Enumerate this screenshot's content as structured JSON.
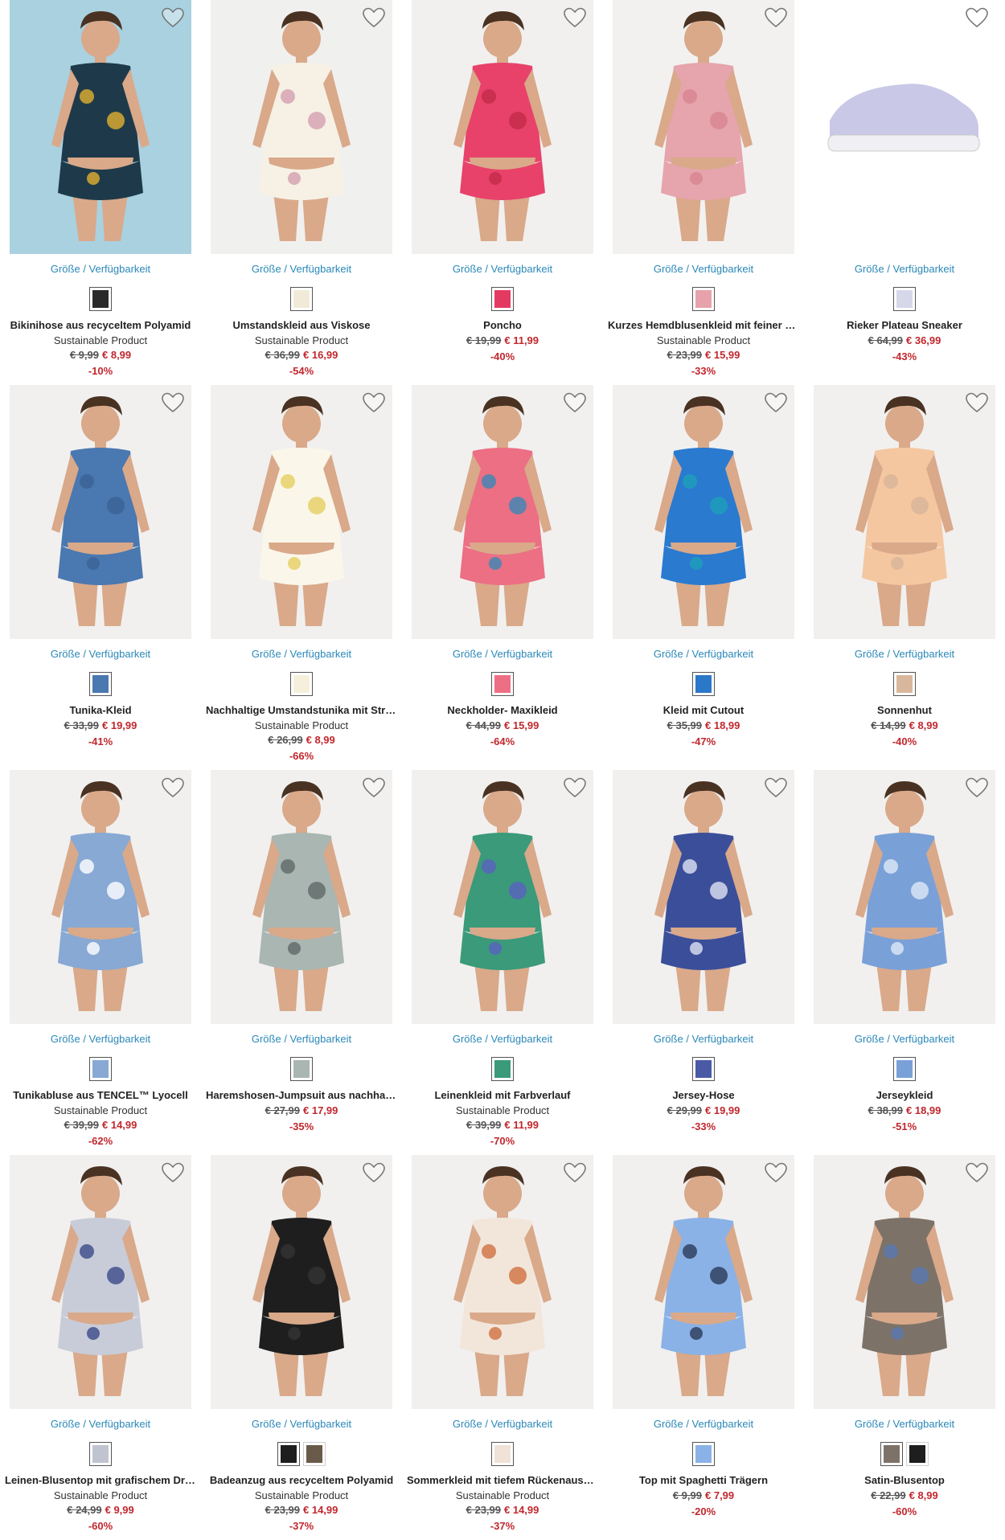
{
  "labels": {
    "availability": "Größe / Verfügbarkeit"
  },
  "products": [
    {
      "name": "Bikinihose aus recyceltem Polyamid",
      "sustainable": "Sustainable Product",
      "old_price": "€ 9,99",
      "new_price": "€ 8,99",
      "discount": "-10%",
      "bg": "#a9d1e0",
      "garment": "#1e3a4a",
      "accent": "#e0b030",
      "swatches": [
        "#2a2a2a"
      ]
    },
    {
      "name": "Umstandskleid aus Viskose",
      "sustainable": "Sustainable Product",
      "old_price": "€ 36,99",
      "new_price": "€ 16,99",
      "discount": "-54%",
      "bg": "#f0f0ee",
      "garment": "#f6f1e4",
      "accent": "#d4a0b0",
      "swatches": [
        "#f1ead8"
      ]
    },
    {
      "name": "Poncho",
      "sustainable": "",
      "old_price": "€ 19,99",
      "new_price": "€ 11,99",
      "discount": "-40%",
      "bg": "#f1f0ef",
      "garment": "#e8426a",
      "accent": "#c22a4a",
      "swatches": [
        "#e43a62"
      ]
    },
    {
      "name": "Kurzes Hemdblusenkleid mit feiner Struktur",
      "sustainable": "Sustainable Product",
      "old_price": "€ 23,99",
      "new_price": "€ 15,99",
      "discount": "-33%",
      "bg": "#f2f1f0",
      "garment": "#e6a4ad",
      "accent": "#d7848f",
      "swatches": [
        "#e7a2ab"
      ]
    },
    {
      "name": "Rieker Plateau Sneaker",
      "sustainable": "",
      "old_price": "€ 64,99",
      "new_price": "€ 36,99",
      "discount": "-43%",
      "bg": "#ffffff",
      "garment": "#c9c8e6",
      "accent": "#efeff4",
      "swatches": [
        "#d7d7ea"
      ]
    },
    {
      "name": "Tunika-Kleid",
      "sustainable": "",
      "old_price": "€ 33,99",
      "new_price": "€ 19,99",
      "discount": "-41%",
      "bg": "#f1f0ef",
      "garment": "#4a78b0",
      "accent": "#3a6196",
      "swatches": [
        "#4a78b0"
      ]
    },
    {
      "name": "Nachhaltige Umstandstunika mit Stretch",
      "sustainable": "Sustainable Product",
      "old_price": "€ 26,99",
      "new_price": "€ 8,99",
      "discount": "-66%",
      "bg": "#f1f0ef",
      "garment": "#faf7ea",
      "accent": "#e6cd60",
      "swatches": [
        "#f5f0dc"
      ]
    },
    {
      "name": "Neckholder- Maxikleid",
      "sustainable": "",
      "old_price": "€ 44,99",
      "new_price": "€ 15,99",
      "discount": "-64%",
      "bg": "#f1f0ef",
      "garment": "#ec6f84",
      "accent": "#3a88b8",
      "swatches": [
        "#ec6f84"
      ]
    },
    {
      "name": "Kleid mit Cutout",
      "sustainable": "",
      "old_price": "€ 35,99",
      "new_price": "€ 18,99",
      "discount": "-47%",
      "bg": "#f1f0ef",
      "garment": "#2a7ad0",
      "accent": "#1ea0b8",
      "swatches": [
        "#2a78c8"
      ]
    },
    {
      "name": "Sonnenhut",
      "sustainable": "",
      "old_price": "€ 14,99",
      "new_price": "€ 8,99",
      "discount": "-40%",
      "bg": "#f1f0ef",
      "garment": "#f5c7a0",
      "accent": "#d8b49a",
      "swatches": [
        "#d9b79c"
      ]
    },
    {
      "name": "Tunikabluse aus TENCEL™ Lyocell",
      "sustainable": "Sustainable Product",
      "old_price": "€ 39,99",
      "new_price": "€ 14,99",
      "discount": "-62%",
      "bg": "#f1f0ef",
      "garment": "#87a9d4",
      "accent": "#ffffff",
      "swatches": [
        "#87a9d4"
      ]
    },
    {
      "name": "Haremshosen-Jumpsuit aus nachhaltiger Viskose",
      "sustainable": "",
      "old_price": "€ 27,99",
      "new_price": "€ 17,99",
      "discount": "-35%",
      "bg": "#f1f0ef",
      "garment": "#a9b6b2",
      "accent": "#5f6a68",
      "swatches": [
        "#a9b6b2"
      ]
    },
    {
      "name": "Leinenkleid mit Farbverlauf",
      "sustainable": "Sustainable Product",
      "old_price": "€ 39,99",
      "new_price": "€ 11,99",
      "discount": "-70%",
      "bg": "#f1f0ef",
      "garment": "#3a9a7a",
      "accent": "#5a60c0",
      "swatches": [
        "#3a9a7a"
      ]
    },
    {
      "name": "Jersey-Hose",
      "sustainable": "",
      "old_price": "€ 29,99",
      "new_price": "€ 19,99",
      "discount": "-33%",
      "bg": "#f1f0ef",
      "garment": "#3b4e9a",
      "accent": "#dfe3f2",
      "swatches": [
        "#4a5aa6"
      ]
    },
    {
      "name": "Jerseykleid",
      "sustainable": "",
      "old_price": "€ 38,99",
      "new_price": "€ 18,99",
      "discount": "-51%",
      "bg": "#f1f0ef",
      "garment": "#7aa0d8",
      "accent": "#dfe8f6",
      "swatches": [
        "#7aa0d8"
      ]
    },
    {
      "name": "Leinen-Blusentop mit grafischem Druck",
      "sustainable": "Sustainable Product",
      "old_price": "€ 24,99",
      "new_price": "€ 9,99",
      "discount": "-60%",
      "bg": "#f1f0ef",
      "garment": "#c8ccd8",
      "accent": "#3a4a8a",
      "swatches": [
        "#bfc4d0"
      ]
    },
    {
      "name": "Badeanzug aus recyceltem Polyamid",
      "sustainable": "Sustainable Product",
      "old_price": "€ 23,99",
      "new_price": "€ 14,99",
      "discount": "-37%",
      "bg": "#f1f0ef",
      "garment": "#1e1e1e",
      "accent": "#333333",
      "swatches": [
        "#1e1e1e",
        "#6a5a4a"
      ]
    },
    {
      "name": "Sommerkleid mit tiefem Rückenausschnitt",
      "sustainable": "Sustainable Product",
      "old_price": "€ 23,99",
      "new_price": "€ 14,99",
      "discount": "-37%",
      "bg": "#f1f0ef",
      "garment": "#f2e6da",
      "accent": "#d07040",
      "swatches": [
        "#f0e2d6"
      ]
    },
    {
      "name": "Top mit Spaghetti Trägern",
      "sustainable": "",
      "old_price": "€ 9,99",
      "new_price": "€ 7,99",
      "discount": "-20%",
      "bg": "#f1f0ef",
      "garment": "#8ab2e6",
      "accent": "#2a3a5a",
      "swatches": [
        "#8ab2e6"
      ]
    },
    {
      "name": "Satin-Blusentop",
      "sustainable": "",
      "old_price": "€ 22,99",
      "new_price": "€ 8,99",
      "discount": "-60%",
      "bg": "#f1f0ef",
      "garment": "#7d7268",
      "accent": "#5878b0",
      "swatches": [
        "#7d7268",
        "#1e1e1e"
      ]
    }
  ]
}
